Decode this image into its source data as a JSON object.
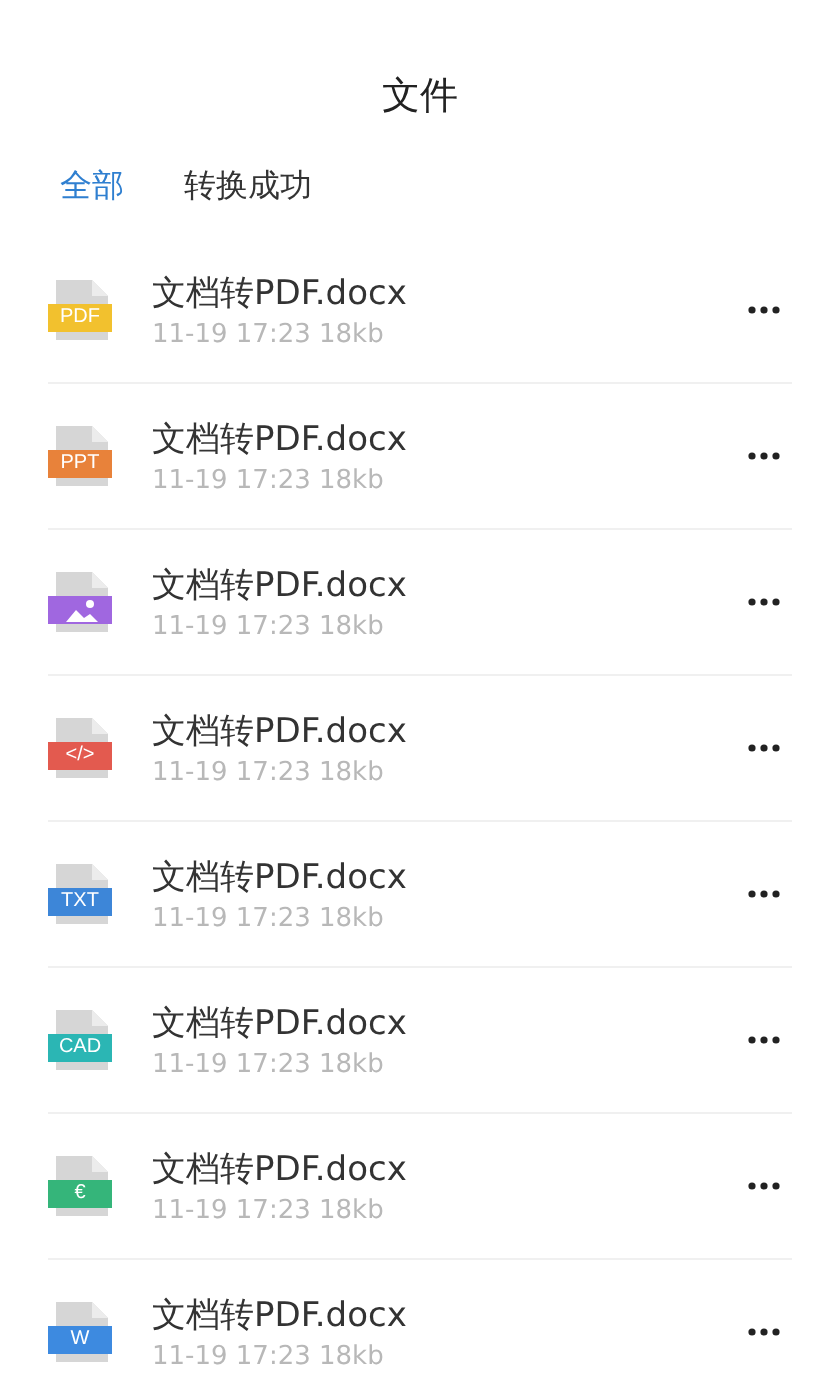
{
  "title": "文件",
  "tabs": [
    {
      "label": "全部",
      "selected": true
    },
    {
      "label": "转换成功",
      "selected": false
    }
  ],
  "files": [
    {
      "name": "文档转PDF.docx",
      "meta": "11-19 17:23 18kb",
      "kind": "label",
      "badge": "PDF",
      "color": "#f2c12e"
    },
    {
      "name": "文档转PDF.docx",
      "meta": "11-19 17:23 18kb",
      "kind": "label",
      "badge": "PPT",
      "color": "#e8823a"
    },
    {
      "name": "文档转PDF.docx",
      "meta": "11-19 17:23 18kb",
      "kind": "image",
      "color": "#a067e0"
    },
    {
      "name": "文档转PDF.docx",
      "meta": "11-19 17:23 18kb",
      "kind": "label",
      "badge": "</>",
      "color": "#e35a4f"
    },
    {
      "name": "文档转PDF.docx",
      "meta": "11-19 17:23 18kb",
      "kind": "label",
      "badge": "TXT",
      "color": "#3d86d8"
    },
    {
      "name": "文档转PDF.docx",
      "meta": "11-19 17:23 18kb",
      "kind": "label",
      "badge": "CAD",
      "color": "#2bb6b4"
    },
    {
      "name": "文档转PDF.docx",
      "meta": "11-19 17:23 18kb",
      "kind": "label",
      "badge": "€",
      "color": "#35b57a"
    },
    {
      "name": "文档转PDF.docx",
      "meta": "11-19 17:23 18kb",
      "kind": "label",
      "badge": "W",
      "color": "#3d8ae0"
    }
  ]
}
